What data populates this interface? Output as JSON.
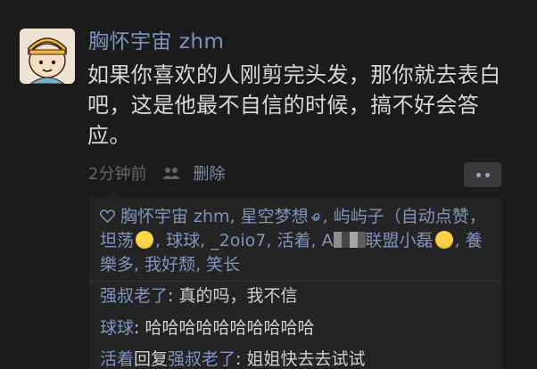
{
  "post": {
    "author": "胸怀宇宙 zhm",
    "text": "如果你喜欢的人刚剪完头发，那你就去表白吧，这是他最不自信的时候，搞不好会答应。",
    "time": "2分钟前",
    "delete_label": "删除"
  },
  "likes": {
    "part1": "胸怀宇宙 zhm, 星空梦想",
    "part2": ", 屿屿子（自动点赞，坦荡",
    "part3": ", 球球, _2oio7, 活着, A",
    "part4": "联盟小磊",
    "part5": ", 養樂多, 我好颓, 笑长"
  },
  "comments": [
    {
      "name": "强叔老了",
      "text": ": 真的吗，我不信"
    },
    {
      "name": "球球",
      "text": ": 哈哈哈哈哈哈哈哈哈哈"
    },
    {
      "name": "活着",
      "reply_word": "回复",
      "reply_to": "强叔老了",
      "text": ": 姐姐快去去试试"
    }
  ],
  "icons": {
    "avatar": "cartoon-boy-avatar",
    "visibility": "people-icon",
    "more": "more-dots-icon",
    "like": "heart-outline-icon"
  },
  "colors": {
    "background": "#1b1b1b",
    "link_blue": "#7f94bf",
    "panel": "#242424"
  }
}
